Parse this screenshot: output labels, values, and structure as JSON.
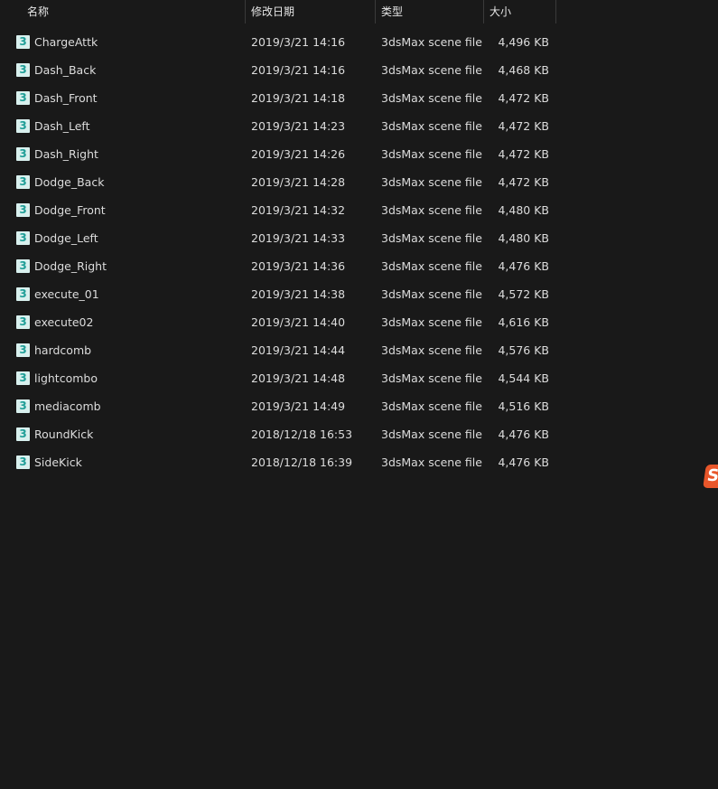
{
  "columns": {
    "name": "名称",
    "date": "修改日期",
    "type": "类型",
    "size": "大小"
  },
  "sort_indicator": "^",
  "files": [
    {
      "name": "ChargeAttk",
      "date": "2019/3/21 14:16",
      "type": "3dsMax scene file",
      "size": "4,496 KB"
    },
    {
      "name": "Dash_Back",
      "date": "2019/3/21 14:16",
      "type": "3dsMax scene file",
      "size": "4,468 KB"
    },
    {
      "name": "Dash_Front",
      "date": "2019/3/21 14:18",
      "type": "3dsMax scene file",
      "size": "4,472 KB"
    },
    {
      "name": "Dash_Left",
      "date": "2019/3/21 14:23",
      "type": "3dsMax scene file",
      "size": "4,472 KB"
    },
    {
      "name": "Dash_Right",
      "date": "2019/3/21 14:26",
      "type": "3dsMax scene file",
      "size": "4,472 KB"
    },
    {
      "name": "Dodge_Back",
      "date": "2019/3/21 14:28",
      "type": "3dsMax scene file",
      "size": "4,472 KB"
    },
    {
      "name": "Dodge_Front",
      "date": "2019/3/21 14:32",
      "type": "3dsMax scene file",
      "size": "4,480 KB"
    },
    {
      "name": "Dodge_Left",
      "date": "2019/3/21 14:33",
      "type": "3dsMax scene file",
      "size": "4,480 KB"
    },
    {
      "name": "Dodge_Right",
      "date": "2019/3/21 14:36",
      "type": "3dsMax scene file",
      "size": "4,476 KB"
    },
    {
      "name": "execute_01",
      "date": "2019/3/21 14:38",
      "type": "3dsMax scene file",
      "size": "4,572 KB"
    },
    {
      "name": "execute02",
      "date": "2019/3/21 14:40",
      "type": "3dsMax scene file",
      "size": "4,616 KB"
    },
    {
      "name": "hardcomb",
      "date": "2019/3/21 14:44",
      "type": "3dsMax scene file",
      "size": "4,576 KB"
    },
    {
      "name": "lightcombo",
      "date": "2019/3/21 14:48",
      "type": "3dsMax scene file",
      "size": "4,544 KB"
    },
    {
      "name": "mediacomb",
      "date": "2019/3/21 14:49",
      "type": "3dsMax scene file",
      "size": "4,516 KB"
    },
    {
      "name": "RoundKick",
      "date": "2018/12/18 16:53",
      "type": "3dsMax scene file",
      "size": "4,476 KB"
    },
    {
      "name": "SideKick",
      "date": "2018/12/18 16:39",
      "type": "3dsMax scene file",
      "size": "4,476 KB"
    }
  ],
  "file_icon": {
    "glyph": "3",
    "name": "3dsmax-file-icon",
    "color": "#1f9e97"
  },
  "badge": {
    "glyph": "S",
    "color": "#e8562a"
  }
}
